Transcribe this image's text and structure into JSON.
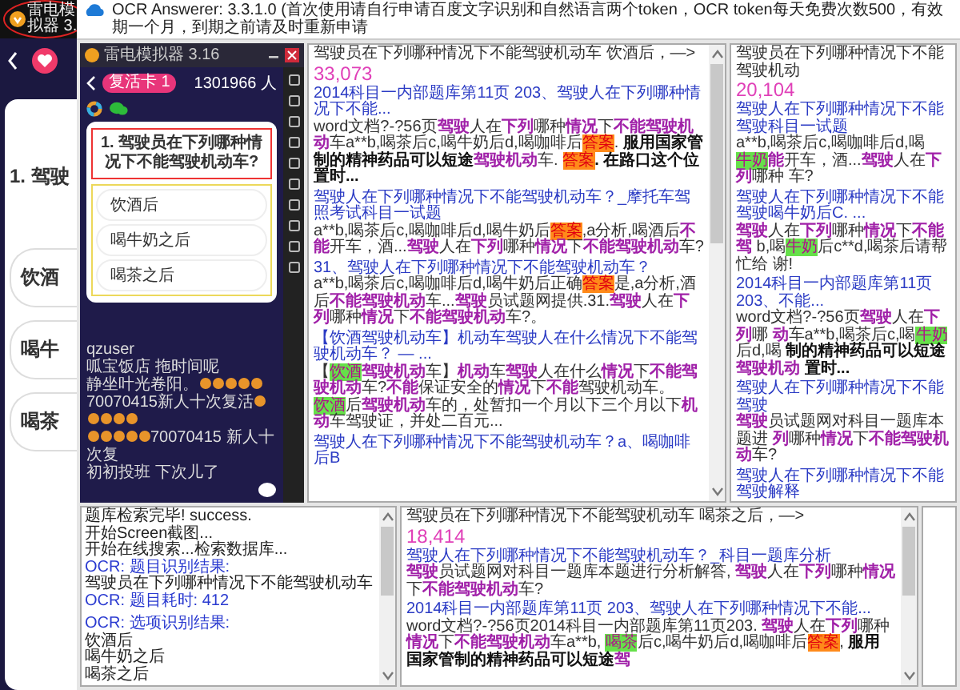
{
  "taskbar": {
    "label": "雷电模拟器 3."
  },
  "background_app": {
    "question": "1. 驾驶",
    "options": [
      "饮酒",
      "喝牛",
      "喝茶"
    ]
  },
  "window": {
    "title": "OCR Answerer: 3.3.1.0 (首次使用请自行申请百度文字识别和自然语言两个token，OCR token每天免费次数500，有效期一个月，到期之前请及时重新申请"
  },
  "emulator": {
    "title": "雷电模拟器 3.16",
    "badge": "复活卡 1",
    "viewers": "1301966 人",
    "question": "1. 驾驶员在下列哪种情况下不能驾驶机动车?",
    "options": [
      "饮酒后",
      "喝牛奶之后",
      "喝茶之后"
    ],
    "chat": [
      {
        "segments": [
          {
            "kind": "text",
            "text": "qzuser"
          }
        ]
      },
      {
        "segments": [
          {
            "kind": "text",
            "text": "呱宝饭店 拖时间呢"
          }
        ]
      },
      {
        "segments": [
          {
            "kind": "text",
            "text": "静坐叶光卷阳。"
          },
          {
            "kind": "trophy"
          },
          {
            "kind": "trophy"
          },
          {
            "kind": "trophy"
          },
          {
            "kind": "trophy"
          },
          {
            "kind": "trophy"
          },
          {
            "kind": "text",
            "text": "70070415新人十次复活"
          },
          {
            "kind": "trophy"
          },
          {
            "kind": "trophy"
          },
          {
            "kind": "trophy"
          },
          {
            "kind": "trophy"
          },
          {
            "kind": "trophy"
          }
        ]
      },
      {
        "segments": [
          {
            "kind": "trophy"
          },
          {
            "kind": "trophy"
          },
          {
            "kind": "trophy"
          },
          {
            "kind": "trophy"
          },
          {
            "kind": "trophy"
          },
          {
            "kind": "text",
            "text": "70070415 新人十次复"
          }
        ]
      },
      {
        "segments": [
          {
            "kind": "text",
            "text": "初初投班 下次儿了"
          }
        ]
      }
    ]
  },
  "log": {
    "lines": [
      {
        "kind": "plain",
        "text": "题库检索完毕! success."
      },
      {
        "kind": "plain",
        "text": "开始Screen截图..."
      },
      {
        "kind": "plain",
        "text": "开始在线搜索...检索数据库..."
      },
      {
        "kind": "info",
        "text": "OCR: 题目识别结果:"
      },
      {
        "kind": "plain",
        "text": "驾驶员在下列哪种情况下不能驾驶机动车"
      },
      {
        "kind": "info",
        "text": "OCR: 题目耗时: 412"
      },
      {
        "kind": "info",
        "text": "OCR: 选项识别结果:"
      },
      {
        "kind": "plain",
        "text": "饮酒后"
      },
      {
        "kind": "plain",
        "text": "喝牛奶之后"
      },
      {
        "kind": "plain",
        "text": "喝茶之后"
      }
    ]
  },
  "results": [
    {
      "query": "驾驶员在下列哪种情况下不能驾驶机动车 饮酒后，—>",
      "count": "33,073",
      "entries": [
        {
          "title": "2014科目一内部题库第11页 203、驾驶人在下列哪种情况下不能...",
          "snippet": [
            {
              "kind": "plain",
              "text": "word文档?-?56页"
            },
            {
              "kind": "keyword",
              "text": "驾驶"
            },
            {
              "kind": "plain",
              "text": "人在"
            },
            {
              "kind": "keyword",
              "text": "下列"
            },
            {
              "kind": "plain",
              "text": "哪种"
            },
            {
              "kind": "keyword",
              "text": "情况"
            },
            {
              "kind": "plain",
              "text": "下"
            },
            {
              "kind": "keyword",
              "text": "不能驾驶机动"
            },
            {
              "kind": "plain",
              "text": "车a**b,喝茶后c,喝牛奶后d,喝咖啡后"
            },
            {
              "kind": "answer",
              "text": "答案"
            },
            {
              "kind": "plain",
              "text": ". "
            },
            {
              "kind": "bold",
              "text": "服用国家管制的精神药品可以短途"
            },
            {
              "kind": "keyword",
              "text": "驾驶机动"
            },
            {
              "kind": "plain",
              "text": "车. "
            },
            {
              "kind": "answer",
              "text": "答案"
            },
            {
              "kind": "bold",
              "text": ". 在路口这个位置时..."
            }
          ]
        },
        {
          "title": "驾驶人在下列哪种情况下不能驾驶机动车？_摩托车驾照考试科目一试题",
          "snippet": [
            {
              "kind": "plain",
              "text": "a**b,喝茶后c,喝咖啡后d,喝牛奶后"
            },
            {
              "kind": "answer",
              "text": "答案"
            },
            {
              "kind": "plain",
              "text": ",a分析,喝酒后"
            },
            {
              "kind": "keyword",
              "text": "不能"
            },
            {
              "kind": "plain",
              "text": "开车，酒..."
            },
            {
              "kind": "keyword",
              "text": "驾驶"
            },
            {
              "kind": "plain",
              "text": "人在"
            },
            {
              "kind": "keyword",
              "text": "下列"
            },
            {
              "kind": "plain",
              "text": "哪种"
            },
            {
              "kind": "keyword",
              "text": "情况"
            },
            {
              "kind": "plain",
              "text": "下"
            },
            {
              "kind": "keyword",
              "text": "不能驾驶机动"
            },
            {
              "kind": "plain",
              "text": "车?"
            }
          ]
        },
        {
          "title": "31、驾驶人在下列哪种情况下不能驾驶机动车？",
          "snippet": [
            {
              "kind": "plain",
              "text": "a**b,喝茶后c,喝咖啡后d,喝牛奶后正确"
            },
            {
              "kind": "answer",
              "text": "答案"
            },
            {
              "kind": "plain",
              "text": "是,a分析,酒后"
            },
            {
              "kind": "keyword",
              "text": "不能驾驶机动"
            },
            {
              "kind": "plain",
              "text": "车..."
            },
            {
              "kind": "keyword",
              "text": "驾驶"
            },
            {
              "kind": "plain",
              "text": "员试题网提供.31."
            },
            {
              "kind": "keyword",
              "text": "驾驶"
            },
            {
              "kind": "plain",
              "text": "人在"
            },
            {
              "kind": "keyword",
              "text": "下列"
            },
            {
              "kind": "plain",
              "text": "哪种"
            },
            {
              "kind": "keyword",
              "text": "情况"
            },
            {
              "kind": "plain",
              "text": "下"
            },
            {
              "kind": "keyword",
              "text": "不能驾驶机动"
            },
            {
              "kind": "plain",
              "text": "车?。"
            }
          ]
        },
        {
          "title": "【饮酒驾驶机动车】机动车驾驶人在什么情况下不能驾驶机动车？ — ...",
          "snippet": [
            {
              "kind": "plain",
              "text": "【"
            },
            {
              "kind": "option",
              "text": "饮酒"
            },
            {
              "kind": "keyword",
              "text": "驾驶机动"
            },
            {
              "kind": "plain",
              "text": "车】"
            },
            {
              "kind": "keyword",
              "text": "机动"
            },
            {
              "kind": "plain",
              "text": "车"
            },
            {
              "kind": "keyword",
              "text": "驾驶"
            },
            {
              "kind": "plain",
              "text": "人在什么"
            },
            {
              "kind": "keyword",
              "text": "情况"
            },
            {
              "kind": "plain",
              "text": "下"
            },
            {
              "kind": "keyword",
              "text": "不能驾驶机动"
            },
            {
              "kind": "plain",
              "text": "车?"
            },
            {
              "kind": "keyword",
              "text": "不能"
            },
            {
              "kind": "plain",
              "text": "保证安全的"
            },
            {
              "kind": "keyword",
              "text": "情况"
            },
            {
              "kind": "plain",
              "text": "下"
            },
            {
              "kind": "keyword",
              "text": "不能"
            },
            {
              "kind": "plain",
              "text": "驾驶机动车。"
            },
            {
              "kind": "option",
              "text": "饮酒"
            },
            {
              "kind": "plain",
              "text": "后"
            },
            {
              "kind": "keyword",
              "text": "驾驶机动"
            },
            {
              "kind": "plain",
              "text": "车的，处暂扣一个月以下三个月以下"
            },
            {
              "kind": "keyword",
              "text": "机动"
            },
            {
              "kind": "plain",
              "text": "车驾驶证，并处二百元..."
            }
          ]
        },
        {
          "title": "驾驶人在下列哪种情况下不能驾驶机动车？a、喝咖啡后B"
        }
      ]
    },
    {
      "query": "驾驶员在下列哪种情况下不能驾驶机动",
      "count": "20,104",
      "entries": [
        {
          "title": "驾驶人在下列哪种情况下不能驾驶科目一试题",
          "snippet": [
            {
              "kind": "plain",
              "text": "a**b,喝茶后c,喝咖啡后d,喝"
            },
            {
              "kind": "option",
              "text": "牛奶"
            },
            {
              "kind": "keyword",
              "text": "能"
            },
            {
              "kind": "plain",
              "text": "开车，酒..."
            },
            {
              "kind": "keyword",
              "text": "驾驶"
            },
            {
              "kind": "plain",
              "text": "人在"
            },
            {
              "kind": "keyword",
              "text": "下列"
            },
            {
              "kind": "plain",
              "text": "哪种 车?"
            }
          ]
        },
        {
          "title": "驾驶人在下列哪种情况下不能驾驶喝牛奶后C. ...",
          "snippet": [
            {
              "kind": "keyword",
              "text": "驾驶"
            },
            {
              "kind": "plain",
              "text": "人在"
            },
            {
              "kind": "keyword",
              "text": "下列"
            },
            {
              "kind": "plain",
              "text": "哪种"
            },
            {
              "kind": "keyword",
              "text": "情况"
            },
            {
              "kind": "plain",
              "text": "下"
            },
            {
              "kind": "keyword",
              "text": "不能驾"
            },
            {
              "kind": "plain",
              "text": " b,喝"
            },
            {
              "kind": "option",
              "text": "牛奶"
            },
            {
              "kind": "plain",
              "text": "后c**d,喝茶后请帮忙给 谢!"
            }
          ]
        },
        {
          "title": "2014科目一内部题库第11页 203、不能...",
          "snippet": [
            {
              "kind": "plain",
              "text": "word文档?-?56页"
            },
            {
              "kind": "keyword",
              "text": "驾驶"
            },
            {
              "kind": "plain",
              "text": "人在"
            },
            {
              "kind": "keyword",
              "text": "下列"
            },
            {
              "kind": "plain",
              "text": "哪 "
            },
            {
              "kind": "keyword",
              "text": "动"
            },
            {
              "kind": "plain",
              "text": "车a**b,喝茶后c,喝"
            },
            {
              "kind": "option",
              "text": "牛奶"
            },
            {
              "kind": "plain",
              "text": "后d,喝 "
            },
            {
              "kind": "bold",
              "text": "制的精神药品可以短途"
            },
            {
              "kind": "keyword",
              "text": "驾驶机动"
            },
            {
              "kind": "bold",
              "text": " 置时..."
            }
          ]
        },
        {
          "title": "驾驶人在下列哪种情况下不能驾驶",
          "snippet": [
            {
              "kind": "keyword",
              "text": "驾驶"
            },
            {
              "kind": "plain",
              "text": "员试题网对科目一题库本题进 "
            },
            {
              "kind": "keyword",
              "text": "列"
            },
            {
              "kind": "plain",
              "text": "哪种"
            },
            {
              "kind": "keyword",
              "text": "情况"
            },
            {
              "kind": "plain",
              "text": "下"
            },
            {
              "kind": "keyword",
              "text": "不能驾驶机动"
            },
            {
              "kind": "plain",
              "text": "车?"
            }
          ]
        },
        {
          "title": "驾驶人在下列哪种情况下不能驾驶解释"
        }
      ]
    },
    {
      "query": "驾驶员在下列哪种情况下不能驾驶机动车 喝茶之后，—>",
      "count": "18,414",
      "entries": [
        {
          "title": "驾驶人在下列哪种情况下不能驾驶机动车？_科目一题库分析",
          "snippet": [
            {
              "kind": "keyword",
              "text": "驾驶"
            },
            {
              "kind": "plain",
              "text": "员试题网对科目一题库本题进行分析解答, "
            },
            {
              "kind": "keyword",
              "text": "驾驶"
            },
            {
              "kind": "plain",
              "text": "人在"
            },
            {
              "kind": "keyword",
              "text": "下列"
            },
            {
              "kind": "plain",
              "text": "哪种"
            },
            {
              "kind": "keyword",
              "text": "情况"
            },
            {
              "kind": "plain",
              "text": "下"
            },
            {
              "kind": "keyword",
              "text": "不能驾驶机动"
            },
            {
              "kind": "plain",
              "text": "车?"
            }
          ]
        },
        {
          "title": "2014科目一内部题库第11页 203、驾驶人在下列哪种情况下不能...",
          "snippet": [
            {
              "kind": "plain",
              "text": "word文档?-?56页2014科目一内部题库第11页203. "
            },
            {
              "kind": "keyword",
              "text": "驾驶"
            },
            {
              "kind": "plain",
              "text": "人在"
            },
            {
              "kind": "keyword",
              "text": "下列"
            },
            {
              "kind": "plain",
              "text": "哪种"
            },
            {
              "kind": "keyword",
              "text": "情况"
            },
            {
              "kind": "plain",
              "text": "下"
            },
            {
              "kind": "keyword",
              "text": "不能驾驶机动"
            },
            {
              "kind": "plain",
              "text": "车a**b, "
            },
            {
              "kind": "option",
              "text": "喝茶"
            },
            {
              "kind": "plain",
              "text": "后c,喝牛奶后d,喝咖啡后"
            },
            {
              "kind": "answer",
              "text": "答案"
            },
            {
              "kind": "plain",
              "text": ", "
            },
            {
              "kind": "bold",
              "text": "服用国家管制的精神药品可以短途"
            },
            {
              "kind": "keyword",
              "text": "驾"
            }
          ]
        }
      ]
    }
  ]
}
